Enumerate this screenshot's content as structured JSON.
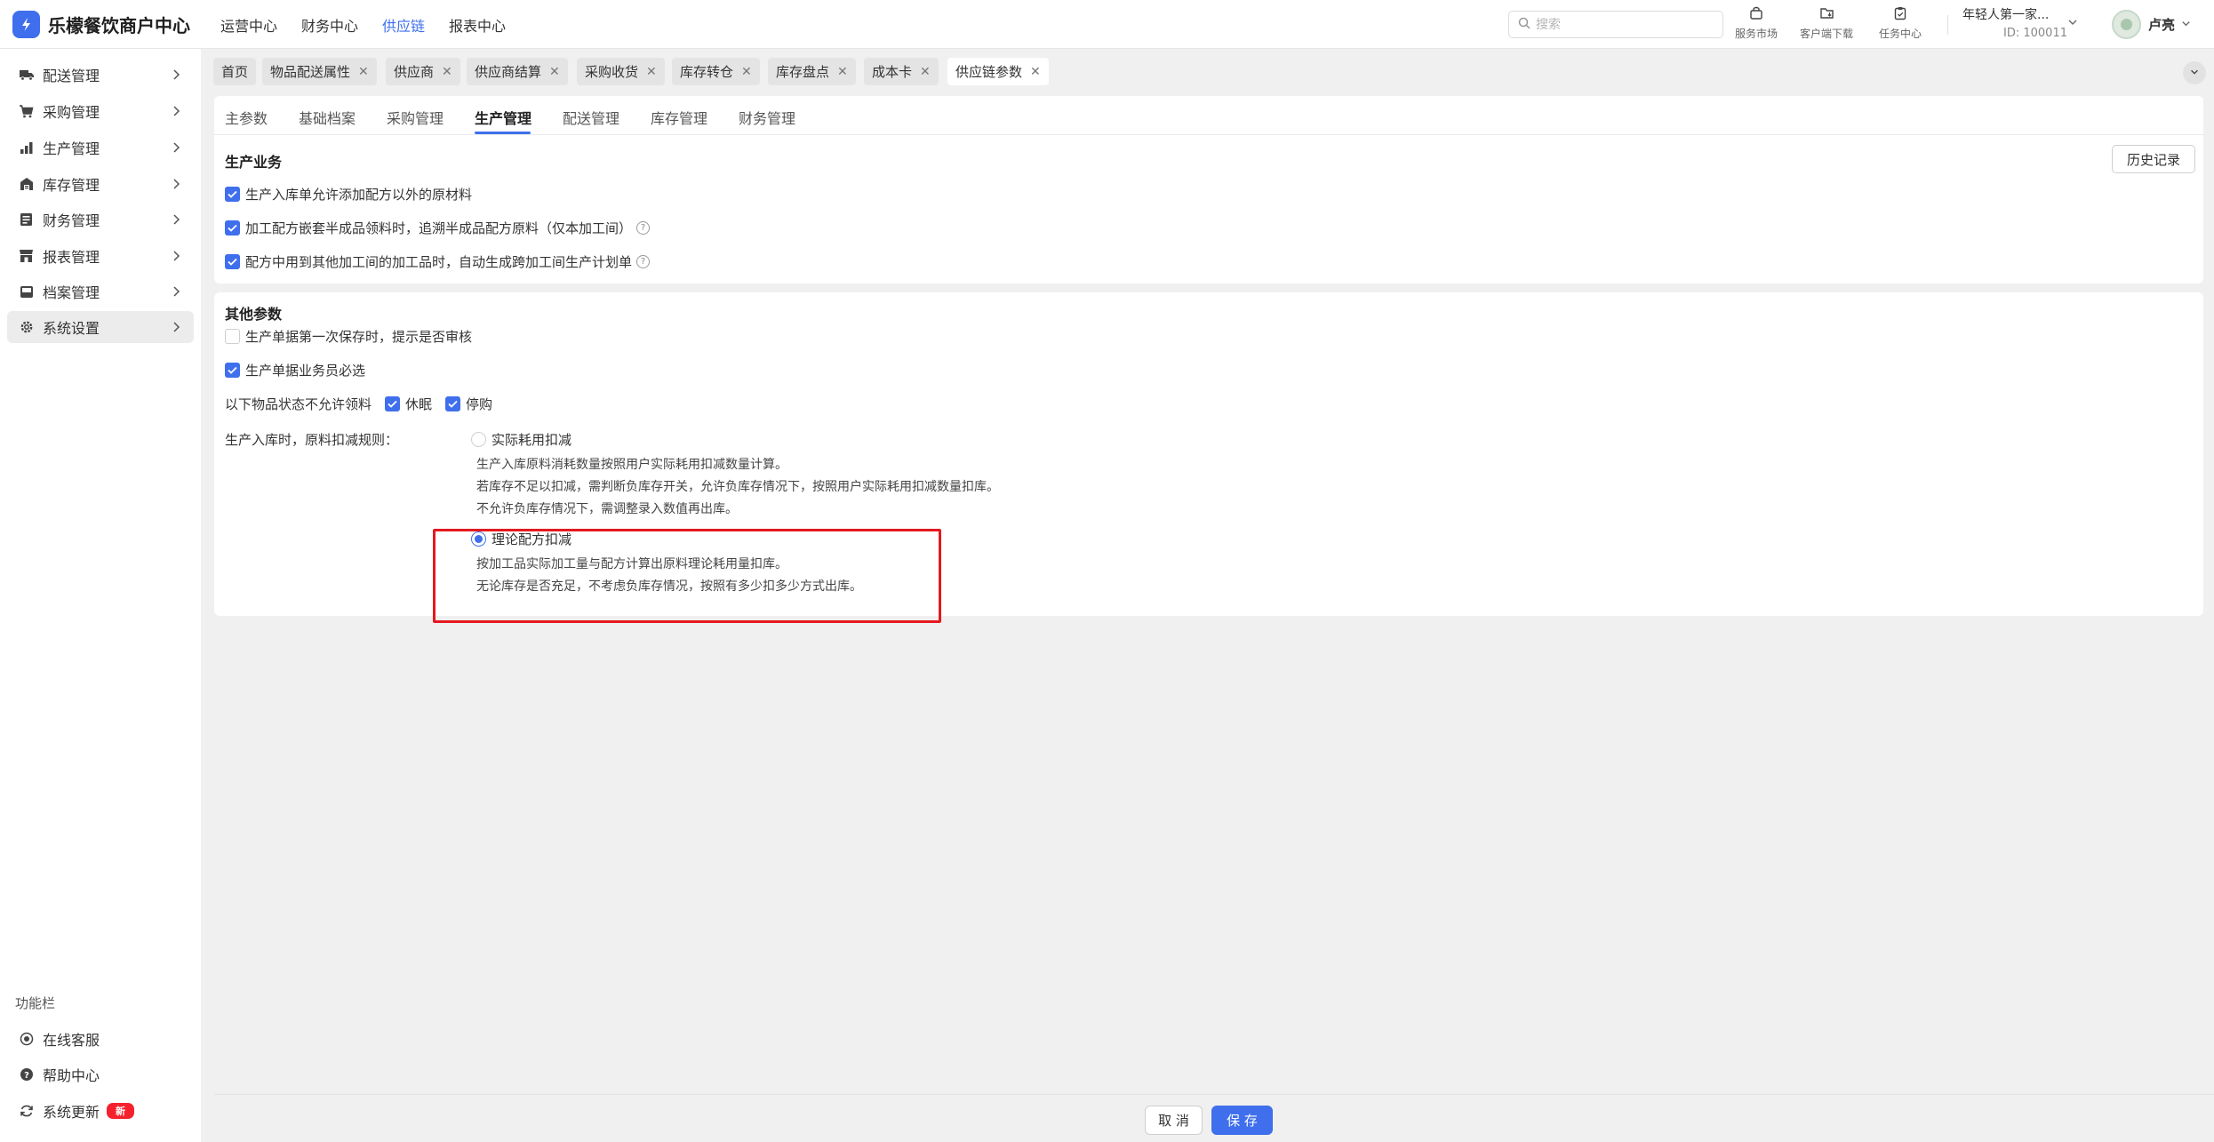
{
  "app": {
    "title": "乐檬餐饮商户中心"
  },
  "topnav": {
    "items": [
      "运营中心",
      "财务中心",
      "供应链",
      "报表中心"
    ],
    "active_index": 2
  },
  "search": {
    "placeholder": "搜索"
  },
  "tools": {
    "market": "服务市场",
    "download": "客户端下载",
    "tasks": "任务中心"
  },
  "account": {
    "name": "年轻人第一家...",
    "id": "ID: 100011"
  },
  "user": {
    "name": "卢亮"
  },
  "sidebar": {
    "items": [
      {
        "label": "配送管理",
        "icon": "truck-icon"
      },
      {
        "label": "采购管理",
        "icon": "cart-icon"
      },
      {
        "label": "生产管理",
        "icon": "factory-icon"
      },
      {
        "label": "库存管理",
        "icon": "warehouse-icon"
      },
      {
        "label": "财务管理",
        "icon": "finance-icon"
      },
      {
        "label": "报表管理",
        "icon": "store-icon"
      },
      {
        "label": "档案管理",
        "icon": "archive-icon"
      },
      {
        "label": "系统设置",
        "icon": "gear-icon"
      }
    ],
    "active_index": 7,
    "func_title": "功能栏",
    "func_items": [
      {
        "label": "在线客服",
        "icon": "headset-icon"
      },
      {
        "label": "帮助中心",
        "icon": "help-icon"
      },
      {
        "label": "系统更新",
        "icon": "refresh-icon",
        "badge": "新"
      }
    ]
  },
  "page_tabs": [
    {
      "label": "首页",
      "closable": false
    },
    {
      "label": "物品配送属性",
      "closable": true
    },
    {
      "label": "供应商",
      "closable": true
    },
    {
      "label": "供应商结算",
      "closable": true
    },
    {
      "label": "采购收货",
      "closable": true
    },
    {
      "label": "库存转仓",
      "closable": true
    },
    {
      "label": "库存盘点",
      "closable": true
    },
    {
      "label": "成本卡",
      "closable": true
    },
    {
      "label": "供应链参数",
      "closable": true,
      "active": true
    }
  ],
  "subtabs": {
    "items": [
      "主参数",
      "基础档案",
      "采购管理",
      "生产管理",
      "配送管理",
      "库存管理",
      "财务管理"
    ],
    "active_index": 3
  },
  "production": {
    "title": "生产业务",
    "history_button": "历史记录",
    "options": [
      {
        "label": "生产入库单允许添加配方以外的原材料",
        "checked": true,
        "help": false
      },
      {
        "label": "加工配方嵌套半成品领料时，追溯半成品配方原料（仅本加工间）",
        "checked": true,
        "help": true
      },
      {
        "label": "配方中用到其他加工间的加工品时，自动生成跨加工间生产计划单",
        "checked": true,
        "help": true
      }
    ]
  },
  "other": {
    "title": "其他参数",
    "options": [
      {
        "label": "生产单据第一次保存时，提示是否审核",
        "checked": false
      },
      {
        "label": "生产单据业务员必选",
        "checked": true
      }
    ],
    "status_label": "以下物品状态不允许领料",
    "status_options": [
      {
        "label": "休眠",
        "checked": true
      },
      {
        "label": "停购",
        "checked": true
      }
    ],
    "rule_label": "生产入库时，原料扣减规则：",
    "rules": [
      {
        "label": "实际耗用扣减",
        "selected": false,
        "desc": [
          "生产入库原料消耗数量按照用户实际耗用扣减数量计算。",
          "若库存不足以扣减，需判断负库存开关，允许负库存情况下，按照用户实际耗用扣减数量扣库。",
          "不允许负库存情况下，需调整录入数值再出库。"
        ]
      },
      {
        "label": "理论配方扣减",
        "selected": true,
        "desc": [
          "按加工品实际加工量与配方计算出原料理论耗用量扣库。",
          "无论库存是否充足，不考虑负库存情况，按照有多少扣多少方式出库。"
        ]
      }
    ]
  },
  "footer": {
    "cancel": "取 消",
    "save": "保 存"
  },
  "colors": {
    "accent": "#3f6fec",
    "highlight": "#e5191f",
    "badge": "#f5222d"
  }
}
